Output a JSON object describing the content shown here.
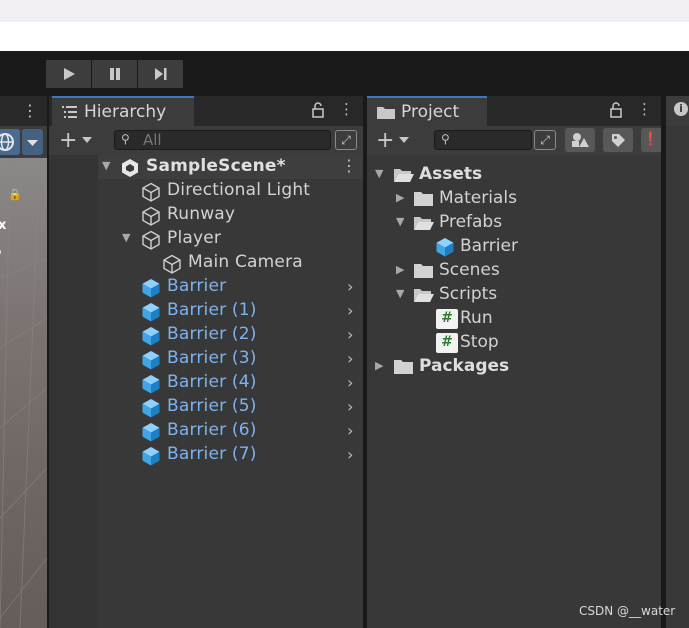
{
  "playbar": {
    "buttons": [
      "play-icon",
      "pause-icon",
      "step-icon"
    ]
  },
  "hierarchy": {
    "tab_label": "Hierarchy",
    "search_placeholder": "All",
    "scene_name": "SampleScene*",
    "items": [
      {
        "label": "Directional Light",
        "type": "gameobject"
      },
      {
        "label": "Runway",
        "type": "gameobject"
      },
      {
        "label": "Player",
        "type": "gameobject",
        "expanded": true
      },
      {
        "label": "Main Camera",
        "type": "gameobject"
      },
      {
        "label": "Barrier",
        "type": "prefab"
      },
      {
        "label": "Barrier (1)",
        "type": "prefab"
      },
      {
        "label": "Barrier (2)",
        "type": "prefab"
      },
      {
        "label": "Barrier (3)",
        "type": "prefab"
      },
      {
        "label": "Barrier (4)",
        "type": "prefab"
      },
      {
        "label": "Barrier (5)",
        "type": "prefab"
      },
      {
        "label": "Barrier (6)",
        "type": "prefab"
      },
      {
        "label": "Barrier (7)",
        "type": "prefab"
      }
    ]
  },
  "project": {
    "tab_label": "Project",
    "items": [
      {
        "label": "Assets",
        "kind": "folder-open"
      },
      {
        "label": "Materials",
        "kind": "folder"
      },
      {
        "label": "Prefabs",
        "kind": "folder-open"
      },
      {
        "label": "Barrier",
        "kind": "prefab"
      },
      {
        "label": "Scenes",
        "kind": "folder"
      },
      {
        "label": "Scripts",
        "kind": "folder-open"
      },
      {
        "label": "Run",
        "kind": "script"
      },
      {
        "label": "Stop",
        "kind": "script"
      },
      {
        "label": "Packages",
        "kind": "folder"
      }
    ]
  },
  "scene_view": {
    "axis_label": "x"
  },
  "watermark": "CSDN @__water",
  "colors": {
    "prefab_text": "#7cb3f2",
    "tab_accent": "#3a79bb",
    "panel_bg": "#383838",
    "toolbar_bg": "#191919"
  }
}
